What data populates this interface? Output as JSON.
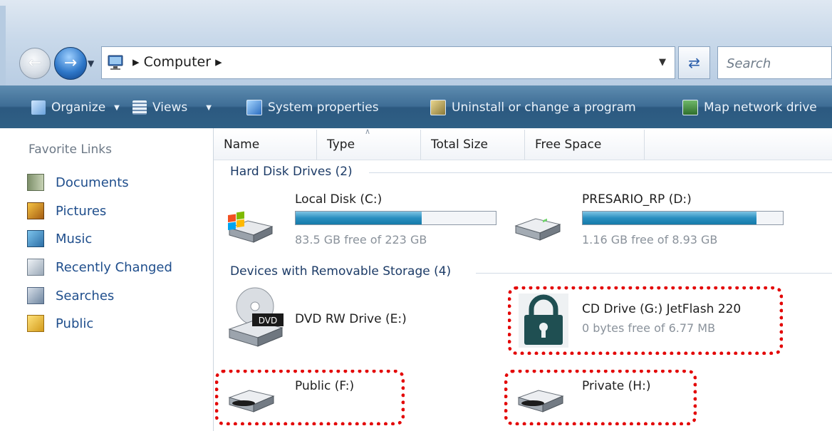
{
  "address": {
    "path": [
      "Computer"
    ],
    "search_placeholder": "Search"
  },
  "toolbar": {
    "items": [
      {
        "label": "Organize",
        "icon": "organize-icon"
      },
      {
        "label": "Views",
        "icon": "views-icon"
      },
      {
        "label": "System properties",
        "icon": "system-properties-icon"
      },
      {
        "label": "Uninstall or change a program",
        "icon": "uninstall-icon"
      },
      {
        "label": "Map network drive",
        "icon": "map-network-drive-icon"
      }
    ]
  },
  "nav": {
    "title": "Favorite Links",
    "items": [
      {
        "label": "Documents",
        "icon": "documents-icon"
      },
      {
        "label": "Pictures",
        "icon": "pictures-icon"
      },
      {
        "label": "Music",
        "icon": "music-icon"
      },
      {
        "label": "Recently Changed",
        "icon": "recently-changed-icon"
      },
      {
        "label": "Searches",
        "icon": "searches-icon"
      },
      {
        "label": "Public",
        "icon": "public-folder-icon"
      }
    ]
  },
  "columns": [
    "Name",
    "Type",
    "Total Size",
    "Free Space"
  ],
  "groups": {
    "hard_disks": "Hard Disk Drives (2)",
    "removable": "Devices with Removable Storage (4)"
  },
  "drives": {
    "c": {
      "name": "Local Disk (C:)",
      "free": "83.5 GB free of 223 GB",
      "used_fraction": 0.63,
      "icon": "windows-hdd-icon"
    },
    "d": {
      "name": "PRESARIO_RP (D:)",
      "free": "1.16 GB free of 8.93 GB",
      "used_fraction": 0.87,
      "icon": "hdd-icon"
    },
    "e": {
      "name": "DVD RW Drive (E:)",
      "icon": "dvd-drive-icon",
      "badge": "DVD"
    },
    "g": {
      "name": "CD Drive (G:) JetFlash 220",
      "free": "0 bytes free of 6.77 MB",
      "icon": "padlock-icon"
    },
    "f": {
      "name": "Public (F:)",
      "icon": "removable-drive-icon"
    },
    "h": {
      "name": "Private (H:)",
      "icon": "removable-drive-icon"
    }
  },
  "colors": {
    "highlight_border": "#e30000",
    "toolbar_bg": "#3e6d95",
    "progress_fill": "#2a8fc0"
  }
}
